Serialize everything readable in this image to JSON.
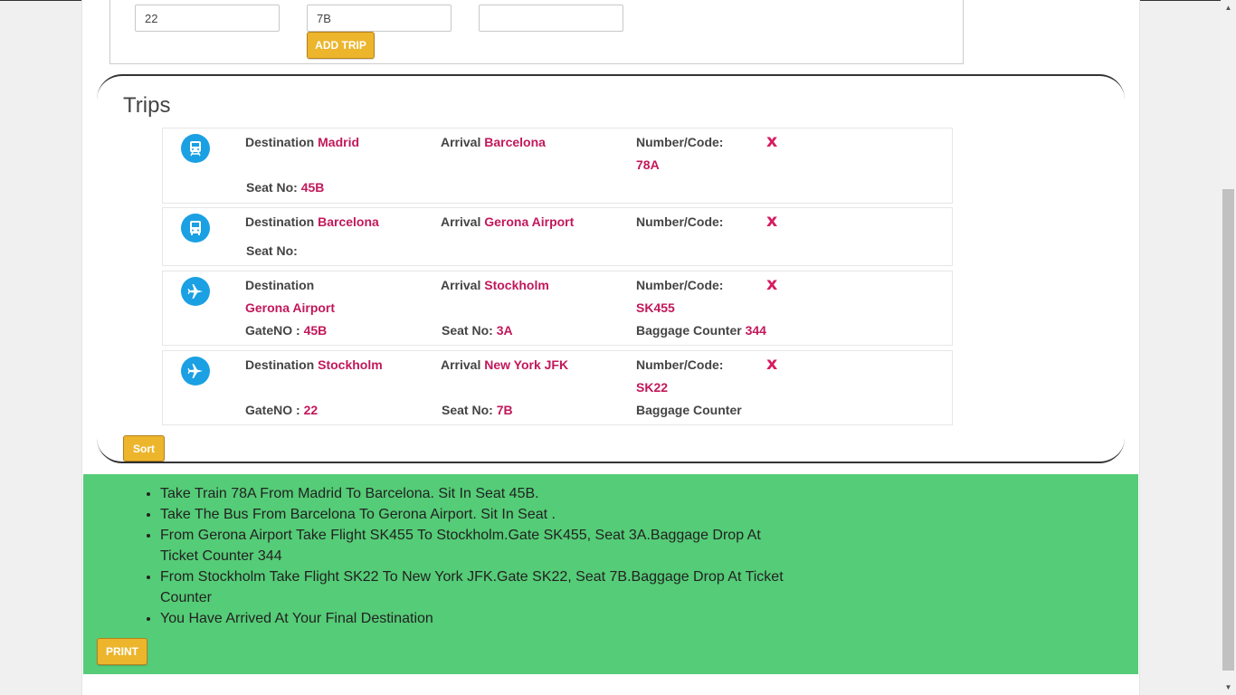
{
  "form": {
    "field1_value": "22",
    "field2_value": "7B",
    "field3_value": "",
    "add_trip_label": "ADD TRIP"
  },
  "trips": {
    "title": "Trips",
    "destination_label": "Destination",
    "arrival_label": "Arrival",
    "number_label": "Number/Code:",
    "seat_label": "Seat No:",
    "gate_label": "GateNO",
    "gate_sep": ":",
    "baggage_label": "Baggage Counter",
    "remove_label": "x",
    "items": [
      {
        "icon": "train-icon",
        "destination": "Madrid",
        "arrival": "Barcelona",
        "number": "78A",
        "seat": "45B"
      },
      {
        "icon": "bus-icon",
        "destination": "Barcelona",
        "arrival": "Gerona Airport",
        "number": "",
        "seat": ""
      },
      {
        "icon": "airplane-icon",
        "destination": "Gerona Airport",
        "arrival": "Stockholm",
        "number": "SK455",
        "gate": "45B",
        "seat": "3A",
        "baggage": "344"
      },
      {
        "icon": "airplane-icon",
        "destination": "Stockholm",
        "arrival": "New York JFK",
        "number": "SK22",
        "gate": "22",
        "seat": "7B",
        "baggage": ""
      }
    ],
    "sort_label": "Sort"
  },
  "instructions": {
    "items": [
      "Take Train 78A From Madrid To Barcelona. Sit In Seat 45B.",
      "Take The Bus From Barcelona To Gerona Airport. Sit In Seat .",
      "From Gerona Airport Take Flight SK455 To Stockholm.Gate SK455, Seat 3A.Baggage Drop At Ticket Counter 344",
      "From Stockholm Take Flight SK22 To New York JFK.Gate SK22, Seat 7B.Baggage Drop At Ticket Counter",
      "You Have Arrived At Your Final Destination"
    ],
    "print_label": "PRINT"
  },
  "colors": {
    "accent_button": "#ecb52c",
    "value_text": "#c2185b",
    "remove_x": "#d81b60",
    "icon_circle": "#1aa0e3",
    "instructions_bg": "#55cc77"
  }
}
